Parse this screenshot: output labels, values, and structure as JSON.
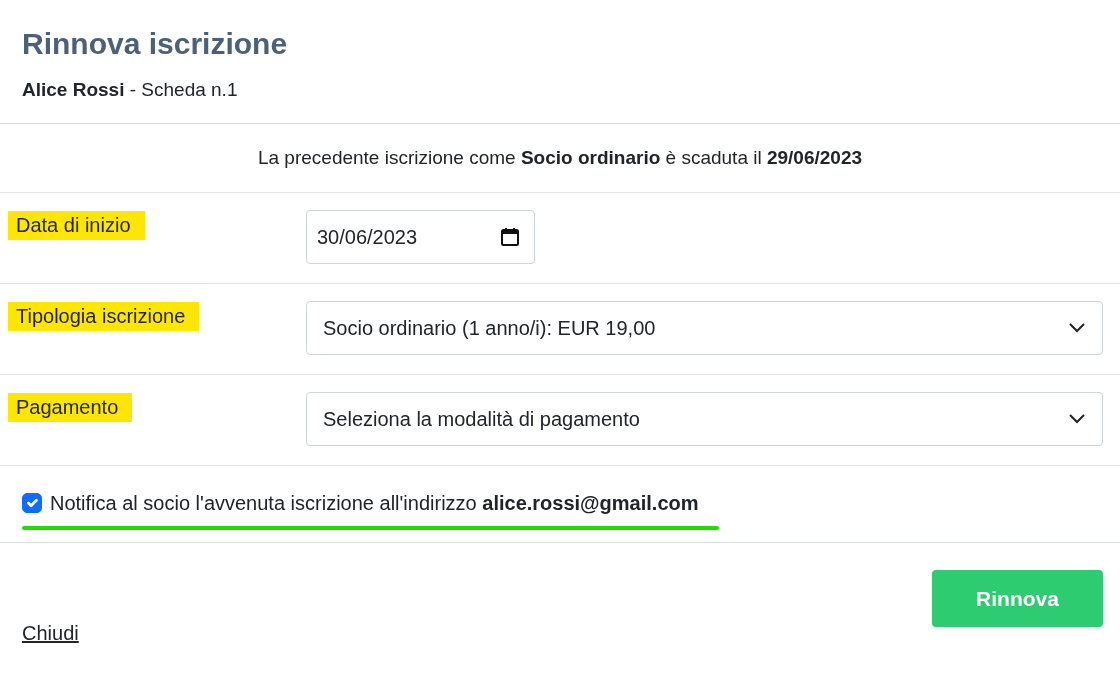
{
  "header": {
    "title": "Rinnova iscrizione",
    "subtitle": "**Alice Rossi** - Scheda n.1"
  },
  "notice": "La precedente iscrizione come **Socio ordinario** è scaduta il **29/06/2023**",
  "fields": [
    {
      "kind": "date",
      "label": "Data di inizio",
      "highlighted": true,
      "value": "30/06/2023"
    },
    {
      "kind": "select",
      "label": "Tipologia iscrizione",
      "highlighted": true,
      "value": "Socio ordinario (1 anno/i): EUR 19,00"
    },
    {
      "kind": "select",
      "label": "Pagamento",
      "highlighted": true,
      "value": "Seleziona la modalità di pagamento"
    }
  ],
  "notify": {
    "checked": true,
    "text": "Notifica al socio l'avvenuta iscrizione all'indirizzo **alice.rossi@gmail.com**",
    "underlined": true
  },
  "footer": {
    "close_link": "Chiudi",
    "submit_button": "Rinnova"
  }
}
